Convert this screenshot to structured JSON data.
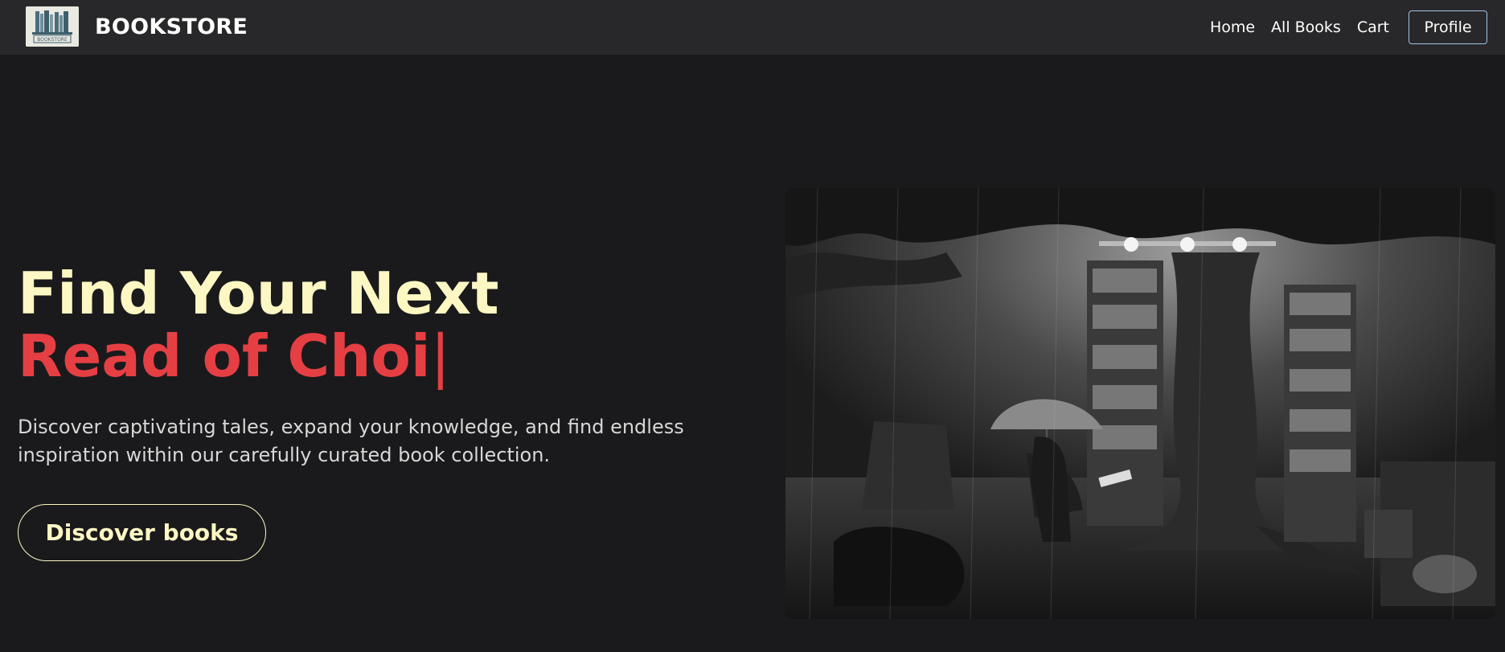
{
  "navbar": {
    "logo_text": "BOOKSTORE",
    "brand": "BOOKSTORE",
    "links": [
      "Home",
      "All Books",
      "Cart"
    ],
    "profile_label": "Profile"
  },
  "hero": {
    "title_line1": "Find Your Next",
    "title_line2": "Read of Choi",
    "cursor": "|",
    "description": "Discover captivating tales, expand your knowledge, and find endless inspiration within our carefully curated book collection.",
    "cta_label": "Discover books"
  },
  "colors": {
    "background": "#1a1a1c",
    "navbar": "#28282a",
    "accent_cream": "#fdf7c3",
    "accent_red": "#e53f44",
    "profile_border": "#9fc2e6"
  },
  "icons": [
    "bookstore-logo-icon"
  ]
}
